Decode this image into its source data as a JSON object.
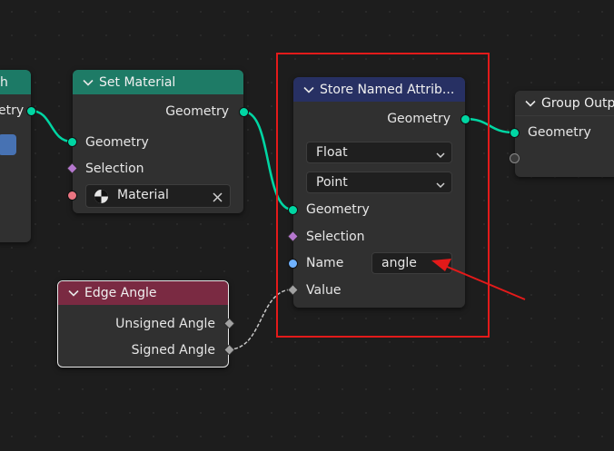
{
  "nodes": {
    "left_partial": {
      "header_text": "h",
      "output_label": "etry",
      "header_color": "#1c7a66"
    },
    "set_material": {
      "title": "Set Material",
      "header_color": "#1e7b66",
      "output_geometry": "Geometry",
      "input_geometry": "Geometry",
      "input_selection": "Selection",
      "material_value": "Material"
    },
    "store_named_attribute": {
      "title": "Store Named Attrib...",
      "header_color": "#273063",
      "output_geometry": "Geometry",
      "data_type": "Float",
      "domain": "Point",
      "input_geometry": "Geometry",
      "input_selection": "Selection",
      "input_name": "Name",
      "name_value": "angle",
      "input_value": "Value"
    },
    "group_output": {
      "title": "Group Outp",
      "header_color": "#303030",
      "input_geometry": "Geometry"
    },
    "edge_angle": {
      "title": "Edge Angle",
      "header_color": "#7a2a42",
      "output_unsigned": "Unsigned Angle",
      "output_signed": "Signed Angle"
    }
  },
  "colors": {
    "geometry_link": "#00d6a3",
    "value_link": "#c8c8c8",
    "highlight_box": "#e31a1a",
    "annotation_arrow": "#e31a1a"
  }
}
